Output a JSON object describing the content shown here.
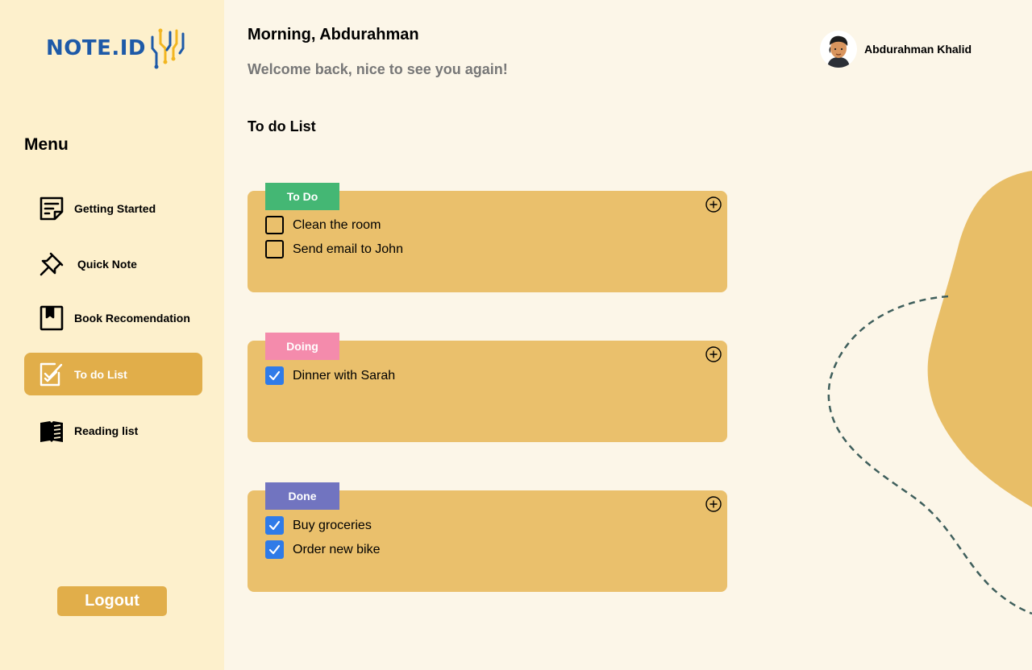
{
  "brand": {
    "name": "NOTE.ID"
  },
  "sidebar": {
    "menu_title": "Menu",
    "items": [
      {
        "label": "Getting Started",
        "icon": "note-icon",
        "active": false
      },
      {
        "label": "Quick Note",
        "icon": "pin-icon",
        "active": false
      },
      {
        "label": "Book Recomendation",
        "icon": "bookmark-icon",
        "active": false
      },
      {
        "label": "To do List",
        "icon": "checklist-icon",
        "active": true
      },
      {
        "label": "Reading list",
        "icon": "open-book-icon",
        "active": false
      }
    ],
    "logout_label": "Logout"
  },
  "header": {
    "greeting": "Morning, Abdurahman",
    "welcome": "Welcome back, nice to see you again!",
    "user_name": "Abdurahman Khalid"
  },
  "main": {
    "title": "To do List",
    "lists": [
      {
        "label": "To Do",
        "tag_color": "#44B774",
        "tasks": [
          {
            "text": "Clean the room",
            "done": false
          },
          {
            "text": "Send email to John",
            "done": false
          }
        ]
      },
      {
        "label": "Doing",
        "tag_color": "#F48BAC",
        "tasks": [
          {
            "text": "Dinner with Sarah",
            "done": true
          }
        ]
      },
      {
        "label": "Done",
        "tag_color": "#7174C0",
        "tasks": [
          {
            "text": "Buy groceries",
            "done": true
          },
          {
            "text": "Order new bike",
            "done": true
          }
        ]
      }
    ]
  },
  "colors": {
    "sidebar_bg": "#FDF0CC",
    "page_bg": "#FCF6E8",
    "accent": "#E1AE4A",
    "card_bg": "#EAC06C",
    "checkbox_checked": "#2F7BE8",
    "brand_blue": "#1E5AA8"
  }
}
